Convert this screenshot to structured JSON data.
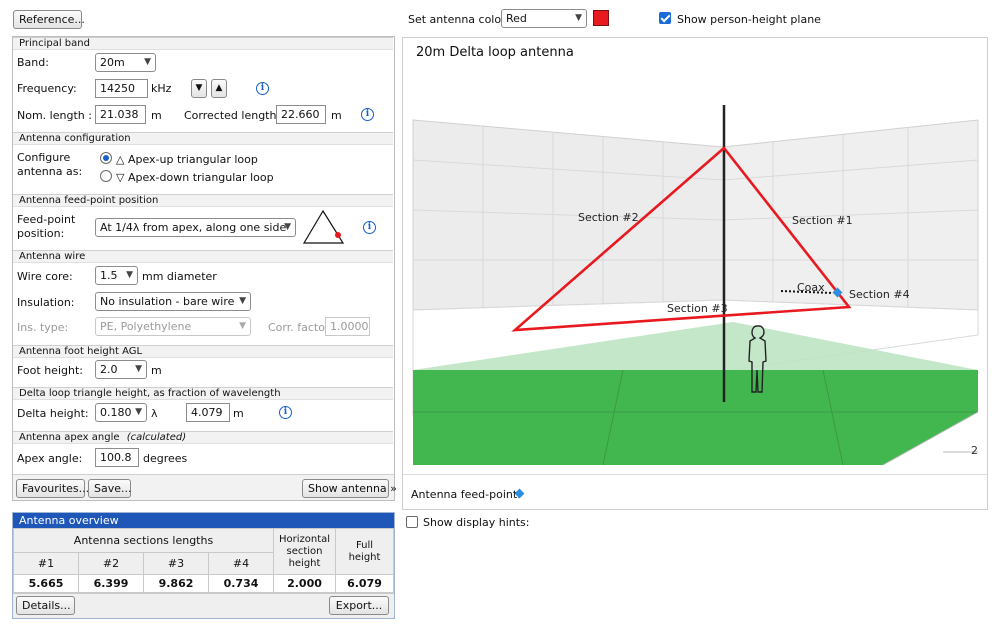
{
  "reference_btn": "Reference...",
  "principal_band": {
    "heading": "Principal band",
    "band_label": "Band:",
    "band_value": "20m",
    "freq_label": "Frequency:",
    "freq_value": "14250",
    "freq_unit": "kHz",
    "nom_label": "Nom. length :",
    "nom_value": "21.038",
    "nom_unit": "m",
    "corr_label": "Corrected length:",
    "corr_value": "22.660",
    "corr_unit": "m"
  },
  "configuration": {
    "heading": "Antenna configuration",
    "label_line1": "Configure",
    "label_line2": "antenna as:",
    "opt1": "△ Apex-up triangular loop",
    "opt2": "▽ Apex-down triangular loop"
  },
  "feedpoint": {
    "heading": "Antenna feed-point position",
    "label_line1": "Feed-point",
    "label_line2": "position:",
    "value": "At 1/4λ from apex, along one side"
  },
  "wire": {
    "heading": "Antenna wire",
    "core_label": "Wire core:",
    "core_value": "1.5",
    "core_unit": "mm diameter",
    "insulation_label": "Insulation:",
    "insulation_value": "No insulation - bare wire",
    "instype_label": "Ins. type:",
    "instype_value": "PE, Polyethylene",
    "corrfactor_label": "Corr. factor:",
    "corrfactor_value": "1.0000"
  },
  "foot": {
    "heading": "Antenna foot height AGL",
    "label": "Foot height:",
    "value": "2.0",
    "unit": "m"
  },
  "delta": {
    "heading": "Delta loop triangle height, as fraction of wavelength",
    "label": "Delta height:",
    "value": "0.180",
    "lambda": "λ",
    "meters": "4.079",
    "unit": "m"
  },
  "apex": {
    "heading": "Antenna apex angle",
    "heading_note": "(calculated)",
    "label": "Apex angle:",
    "value": "100.8",
    "unit": "degrees"
  },
  "buttons": {
    "favourites": "Favourites...",
    "save": "Save...",
    "show_antenna": "Show antenna »"
  },
  "overview": {
    "title": "Antenna overview",
    "sections_header": "Antenna sections lengths",
    "horizontal_header": [
      "Horizontal",
      "section",
      "height"
    ],
    "full_header": [
      "Full",
      "height"
    ],
    "cols": [
      "#1",
      "#2",
      "#3",
      "#4"
    ],
    "values": [
      "5.665",
      "6.399",
      "9.862",
      "0.734"
    ],
    "horizontal_value": "2.000",
    "full_value": "6.079",
    "details_btn": "Details...",
    "export_btn": "Export..."
  },
  "top": {
    "color_label": "Set antenna color:",
    "color_value": "Red",
    "swatch": "#e8191f",
    "plane_label": "Show person-height plane"
  },
  "view": {
    "title": "20m Delta loop antenna",
    "section1": "Section #1",
    "section2": "Section #2",
    "section3": "Section #3",
    "section4": "Section #4",
    "coax": "Coax",
    "corner_number": "2",
    "feedpoint_label": "Antenna feed-point:",
    "antenna_color": "#e8191f",
    "ground_color": "#43b74f",
    "feed_color": "#2d8fe0"
  },
  "hints_label": "Show display hints:"
}
